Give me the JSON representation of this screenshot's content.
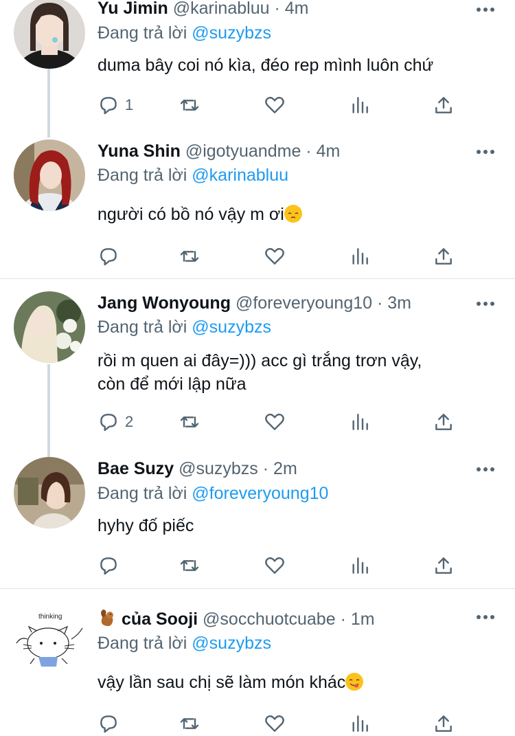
{
  "colors": {
    "accent": "#1d9bf0",
    "muted": "#536471",
    "text": "#0f1419",
    "line": "#cfd9de"
  },
  "tweets": [
    {
      "name": "Yu Jimin",
      "handle": "@karinabluu",
      "time": "4m",
      "sep": "·",
      "reply_label": "Đang trả lời",
      "reply_handle": "@suzybzs",
      "text": "duma bây coi nó kìa, đéo rep mình luôn chứ",
      "reply_count": "1"
    },
    {
      "name": "Yuna Shin",
      "handle": "@igotyuandme",
      "time": "4m",
      "sep": "·",
      "reply_label": "Đang trả lời",
      "reply_handle": "@karinabluu",
      "text": "người có bồ nó vậy m ơi",
      "emoji": "pensive-face"
    },
    {
      "name": "Jang Wonyoung",
      "handle": "@foreveryoung10",
      "time": "3m",
      "sep": "·",
      "reply_label": "Đang trả lời",
      "reply_handle": "@suzybzs",
      "text_line1": "rồi m quen ai đây=))) acc gì trắng trơn vậy,",
      "text_line2": "còn để mới lập nữa",
      "reply_count": "2"
    },
    {
      "name": "Bae Suzy",
      "handle": "@suzybzs",
      "time": "2m",
      "sep": "·",
      "reply_label": "Đang trả lời",
      "reply_handle": "@foreveryoung10",
      "text": "hyhy đố piếc"
    },
    {
      "name_emoji": "squirrel-emoji",
      "name": "của Sooji",
      "handle": "@socchuotcuabe",
      "time": "1m",
      "sep": "·",
      "reply_label": "Đang trả lời",
      "reply_handle": "@suzybzs",
      "text": "vậy lần sau chị sẽ làm món khác",
      "emoji": "yum-face",
      "avatar_caption": "thinking"
    }
  ]
}
